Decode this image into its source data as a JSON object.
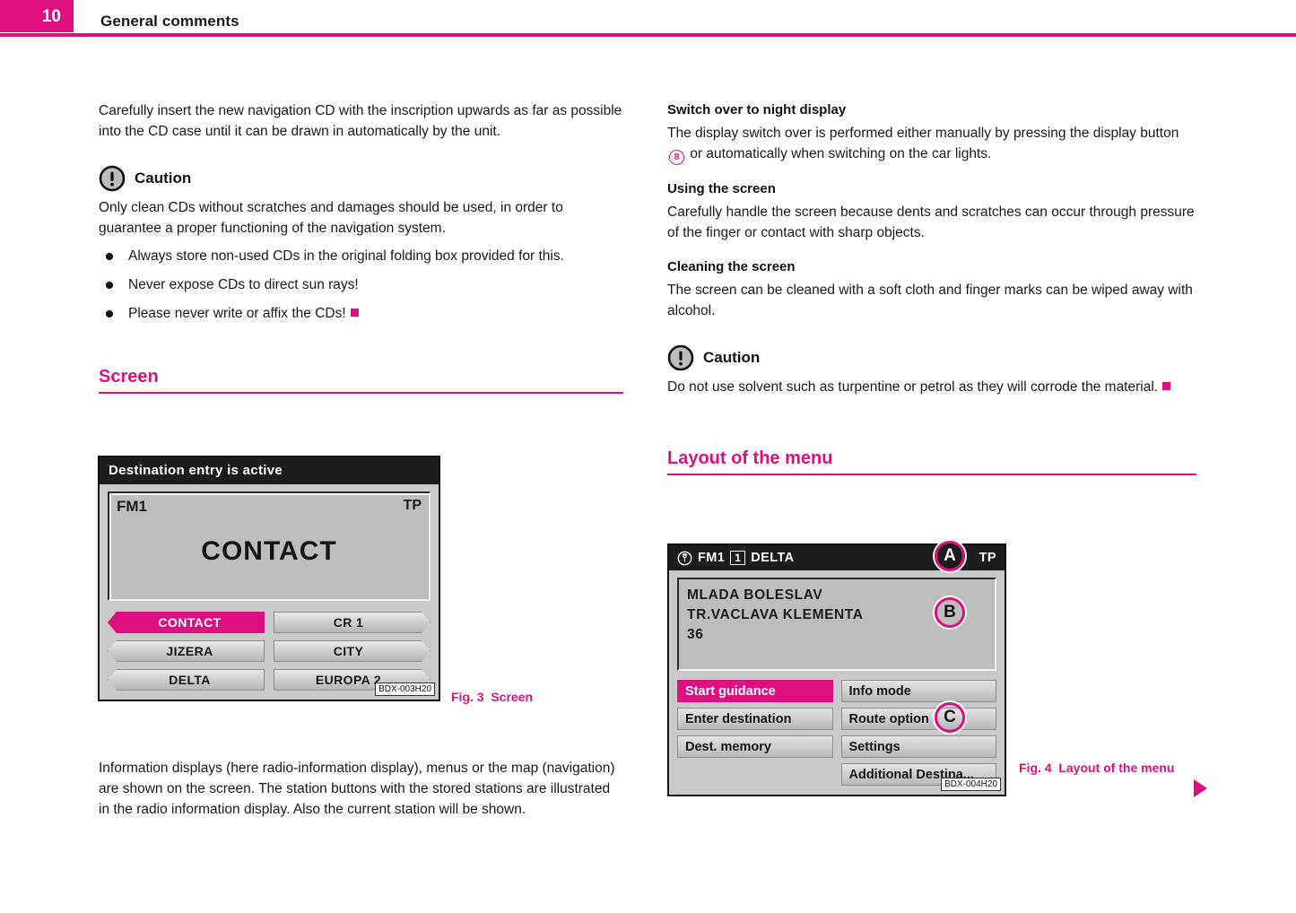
{
  "header": {
    "page_number": "10",
    "title": "General comments",
    "accent_color": "#DE1080"
  },
  "left_column": {
    "intro_paragraph": "Carefully insert the new navigation CD with the inscription upwards as far as possible into the CD case until it can be drawn in automatically by the unit.",
    "caution": {
      "icon": "caution-exclamation-icon",
      "label": "Caution",
      "text": "Only clean CDs without scratches and damages should be used, in order to guarantee a proper functioning of the navigation system."
    },
    "bullets": [
      "Always store non-used CDs in the original folding box provided for this.",
      "Never expose CDs to direct sun rays!",
      "Please never write or affix the CDs!"
    ],
    "section_heading": "Screen",
    "closing_paragraph": "Information displays (here radio-information display), menus or the map (navigation) are shown on the screen. The station buttons with the stored stations are illustrated in the radio information display. Also the current station will be shown."
  },
  "right_column": {
    "sub1_heading": "Switch over to night display",
    "sub1_text_before": "The display switch over is performed either manually by pressing the display button",
    "sub1_ref": "8",
    "sub1_text_after": "or automatically when switching on the car lights.",
    "sub2_heading": "Using the screen",
    "sub2_text": "Carefully handle the screen because dents and scratches can occur through pressure of the finger or contact with sharp objects.",
    "sub3_heading": "Cleaning the screen",
    "sub3_text": "The screen can be cleaned with a soft cloth and finger marks can be wiped away with alcohol.",
    "caution": {
      "icon": "caution-exclamation-icon",
      "label": "Caution",
      "text": "Do not use solvent such as turpentine or petrol as they will corrode the material."
    },
    "section_heading": "Layout of the menu"
  },
  "figure3": {
    "titlebar": "Destination entry is active",
    "info": {
      "band": "FM1",
      "tp": "TP",
      "station": "CONTACT"
    },
    "buttons_left": [
      {
        "label": "CONTACT",
        "active": true
      },
      {
        "label": "JIZERA",
        "active": false
      },
      {
        "label": "DELTA",
        "active": false
      }
    ],
    "buttons_right": [
      {
        "label": "CR 1",
        "active": false
      },
      {
        "label": "CITY",
        "active": false
      },
      {
        "label": "EUROPA 2",
        "active": false
      }
    ],
    "code_tag": "BDX-003H20",
    "caption_number": "Fig. 3",
    "caption_text": "Screen"
  },
  "figure4": {
    "titlebar": {
      "icon": "antenna-broadcast-icon",
      "band": "FM1",
      "preset": "1",
      "station": "DELTA",
      "tp": "TP"
    },
    "address_lines": [
      "MLADA BOLESLAV",
      "TR.VACLAVA KLEMENTA",
      "36"
    ],
    "menu_left": [
      {
        "label": "Start guidance",
        "active": true
      },
      {
        "label": "Enter destination",
        "active": false
      },
      {
        "label": "Dest. memory",
        "active": false
      }
    ],
    "menu_right": [
      {
        "label": "Info mode",
        "active": false
      },
      {
        "label": "Route option",
        "active": false
      },
      {
        "label": "Settings",
        "active": false
      },
      {
        "label": "Additional Destina...",
        "active": false
      }
    ],
    "callouts": [
      {
        "label": "A"
      },
      {
        "label": "B"
      },
      {
        "label": "C"
      }
    ],
    "code_tag": "BDX-004H20",
    "caption_number": "Fig. 4",
    "caption_text": "Layout of the menu"
  }
}
